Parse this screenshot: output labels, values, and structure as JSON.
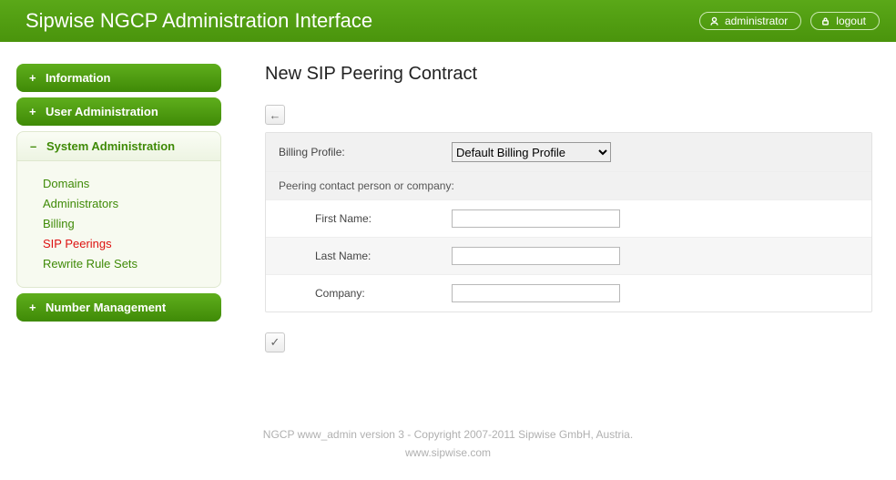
{
  "header": {
    "title": "Sipwise NGCP Administration Interface",
    "user_label": "administrator",
    "logout_label": "logout"
  },
  "sidebar": {
    "information": {
      "label": "Information"
    },
    "user_admin": {
      "label": "User Administration"
    },
    "system_admin": {
      "label": "System Administration",
      "items": {
        "domains": "Domains",
        "administrators": "Administrators",
        "billing": "Billing",
        "sip_peerings": "SIP Peerings",
        "rewrite_rule_sets": "Rewrite Rule Sets"
      }
    },
    "number_mgmt": {
      "label": "Number Management"
    }
  },
  "main": {
    "title": "New SIP Peering Contract",
    "billing_profile_label": "Billing Profile:",
    "billing_profile_selected": "Default Billing Profile",
    "section_contact": "Peering contact person or company:",
    "first_name_label": "First Name:",
    "last_name_label": "Last Name:",
    "company_label": "Company:",
    "first_name_value": "",
    "last_name_value": "",
    "company_value": ""
  },
  "footer": {
    "line1": "NGCP www_admin version 3 - Copyright 2007-2011 Sipwise GmbH, Austria.",
    "line2": "www.sipwise.com"
  },
  "icons": {
    "back_arrow": "←",
    "check": "✓",
    "plus": "+",
    "minus": "–"
  }
}
